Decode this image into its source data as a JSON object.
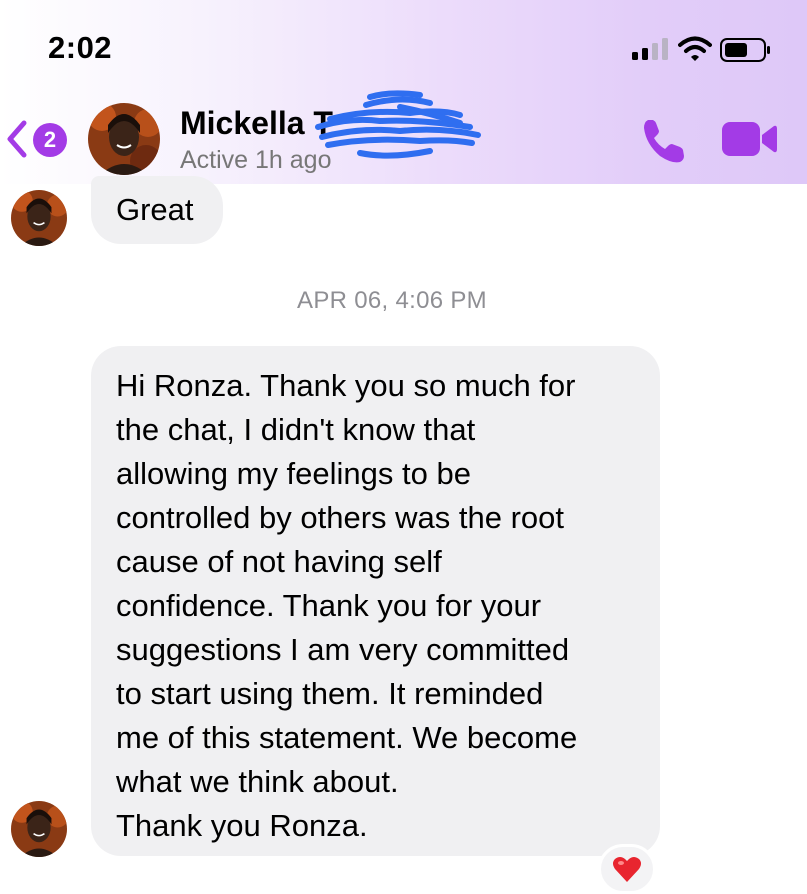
{
  "status_bar": {
    "time": "2:02"
  },
  "header": {
    "back_badge_count": "2",
    "contact_name": "Mickella T",
    "contact_status": "Active 1h ago",
    "accent_color": "#a33be6"
  },
  "messages": [
    {
      "sender": "contact",
      "text": "Great"
    },
    {
      "sender": "contact",
      "text": "Hi Ronza. Thank you so much for\nthe chat, I didn't know that\nallowing my feelings to be\ncontrolled by others was the root\ncause of not having self\nconfidence. Thank you for your\nsuggestions I am very committed\nto start using them. It reminded\nme of this statement. We become\nwhat we think about.\nThank you Ronza.",
      "reaction": "heart"
    }
  ],
  "timestamp": "APR 06, 4:06 PM",
  "icons": {
    "back": "chevron-left-icon",
    "call": "phone-icon",
    "video": "video-camera-icon",
    "reaction": "heart-icon"
  }
}
